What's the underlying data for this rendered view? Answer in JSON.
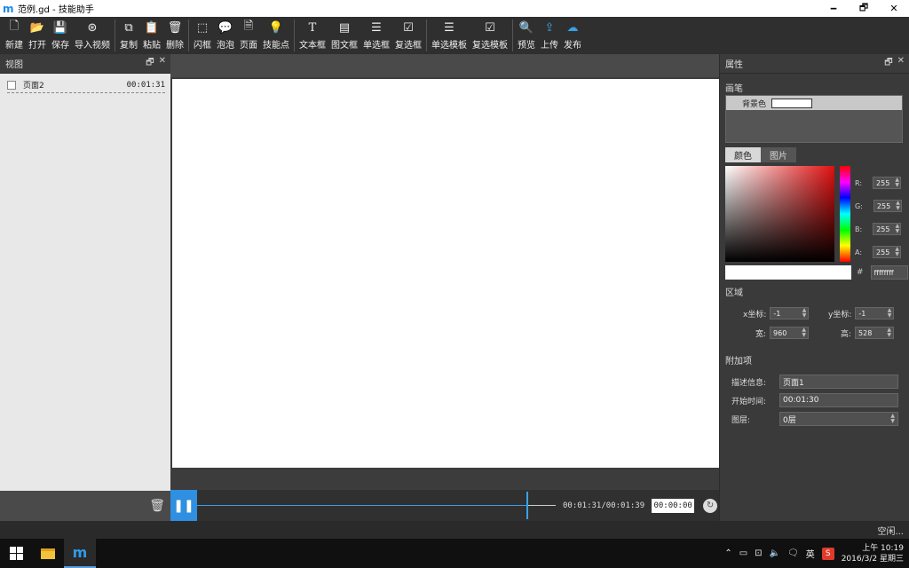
{
  "window": {
    "app_icon": "m-logo-icon",
    "title": "范例.gd  - 技能助手",
    "minimize": "🗕",
    "restore": "🗗",
    "close": "✕"
  },
  "toolbar": {
    "items": [
      {
        "label": "新建",
        "icon": "new-file-icon"
      },
      {
        "label": "打开",
        "icon": "open-folder-icon"
      },
      {
        "label": "保存",
        "icon": "save-icon"
      },
      {
        "label": "导入视频",
        "icon": "film-reel-icon"
      },
      {
        "label": "复制",
        "icon": "copy-icon"
      },
      {
        "label": "粘贴",
        "icon": "paste-icon"
      },
      {
        "label": "删除",
        "icon": "trash-icon"
      },
      {
        "label": "闪框",
        "icon": "dashed-frame-icon"
      },
      {
        "label": "泡泡",
        "icon": "speech-bubble-icon"
      },
      {
        "label": "页面",
        "icon": "page-icon"
      },
      {
        "label": "技能点",
        "icon": "lightbulb-icon"
      },
      {
        "label": "文本框",
        "icon": "text-icon"
      },
      {
        "label": "图文框",
        "icon": "image-text-icon"
      },
      {
        "label": "单选框",
        "icon": "radio-list-icon"
      },
      {
        "label": "复选框",
        "icon": "checkbox-list-icon"
      },
      {
        "label": "单选模板",
        "icon": "radio-template-icon"
      },
      {
        "label": "复选模板",
        "icon": "checkbox-template-icon"
      },
      {
        "label": "预览",
        "icon": "search-icon"
      },
      {
        "label": "上传",
        "icon": "upload-icon"
      },
      {
        "label": "发布",
        "icon": "cloud-publish-icon"
      }
    ]
  },
  "left_panel": {
    "title": "视图",
    "pages": [
      {
        "name": "页面2",
        "time": "00:01:31"
      }
    ]
  },
  "playback": {
    "progress": 0.92,
    "time_display": "00:01:31/00:01:39",
    "time_input": "00:00:00"
  },
  "properties": {
    "title": "属性",
    "brush_section": "画笔",
    "bg_color_label": "背景色",
    "bg_color": "#ffffff",
    "tab_color": "颜色",
    "tab_image": "图片",
    "r_label": "R:",
    "g_label": "G:",
    "b_label": "B:",
    "a_label": "A:",
    "r": "255",
    "g": "255",
    "b": "255",
    "a": "255",
    "hex_label": "#",
    "hex": "ffffffff",
    "region_section": "区域",
    "x_label": "x坐标:",
    "x": "-1",
    "y_label": "y坐标:",
    "y": "-1",
    "w_label": "宽:",
    "w": "960",
    "h_label": "高:",
    "h": "528",
    "extra_section": "附加项",
    "desc_label": "描述信息:",
    "desc": "页面1",
    "start_label": "开始时间:",
    "start": "00:01:30",
    "layer_label": "图层:",
    "layer": "0层"
  },
  "status": {
    "text": "空闲..."
  },
  "taskbar": {
    "ime": "英",
    "sogou": "S",
    "time": "上午 10:19",
    "date": "2016/3/2 星期三"
  }
}
